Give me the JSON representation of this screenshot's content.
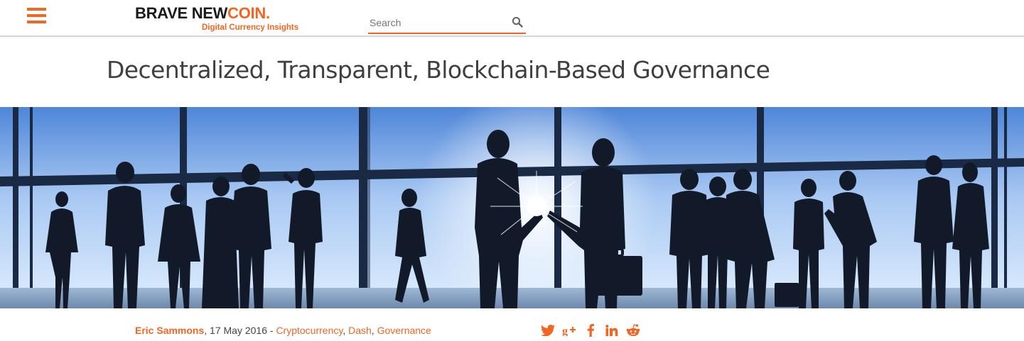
{
  "header": {
    "menu_icon": "hamburger-menu-icon",
    "logo": {
      "brand_part1": "BRAVE NEW",
      "brand_part2": "COIN",
      "brand_dot": ".",
      "tagline": "Digital Currency Insights"
    },
    "search": {
      "placeholder": "Search",
      "value": "",
      "icon": "search-icon"
    }
  },
  "article": {
    "title": "Decentralized, Transparent, Blockchain-Based Governance",
    "hero_image": "business-people-silhouettes-handshake",
    "byline": {
      "author": "Eric Sammons",
      "date_text": ", 17 May 2016 - ",
      "categories": [
        "Cryptocurrency",
        "Dash",
        "Governance"
      ],
      "separator": ", "
    },
    "share_icons": [
      "twitter-icon",
      "google-plus-icon",
      "facebook-icon",
      "linkedin-icon",
      "reddit-icon"
    ]
  },
  "colors": {
    "accent": "#f26522",
    "text": "#3f3f3f",
    "sky": "#cfe3fb"
  }
}
